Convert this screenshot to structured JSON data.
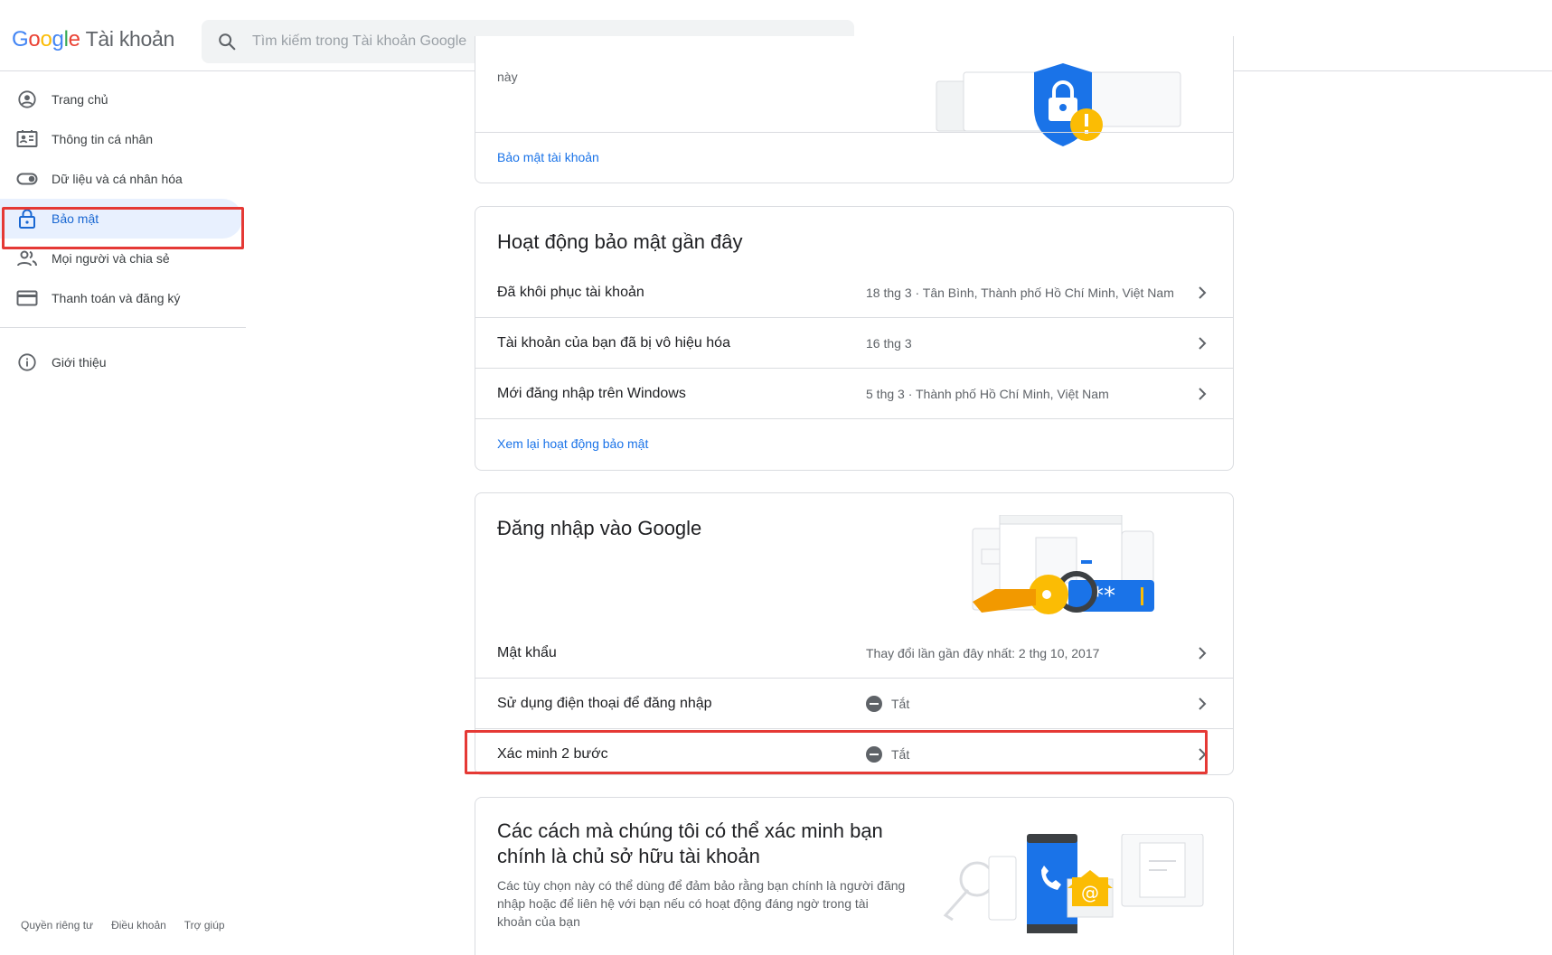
{
  "header": {
    "logo_letters": [
      "G",
      "o",
      "o",
      "g",
      "l",
      "e"
    ],
    "product": "Tài khoản",
    "search_placeholder": "Tìm kiếm trong Tài khoản Google"
  },
  "sidebar": {
    "items": [
      {
        "label": "Trang chủ",
        "icon": "account-circle-icon"
      },
      {
        "label": "Thông tin cá nhân",
        "icon": "contact-card-icon"
      },
      {
        "label": "Dữ liệu và cá nhân hóa",
        "icon": "toggle-icon"
      },
      {
        "label": "Bảo mật",
        "icon": "lock-icon",
        "active": true
      },
      {
        "label": "Mọi người và chia sẻ",
        "icon": "people-icon"
      },
      {
        "label": "Thanh toán và đăng ký",
        "icon": "credit-card-icon"
      }
    ],
    "about": {
      "label": "Giới thiệu",
      "icon": "info-icon"
    }
  },
  "footer": {
    "privacy": "Quyền riêng tư",
    "terms": "Điều khoản",
    "help": "Trợ giúp"
  },
  "security_card": {
    "partial_text": "này",
    "link": "Bảo mật tài khoản"
  },
  "recent_activity": {
    "title": "Hoạt động bảo mật gần đây",
    "rows": [
      {
        "label": "Đã khôi phục tài khoản",
        "value": "18 thg 3 · Tân Bình, Thành phố Hồ Chí Minh, Việt Nam"
      },
      {
        "label": "Tài khoản của bạn đã bị vô hiệu hóa",
        "value": "16 thg 3"
      },
      {
        "label": "Mới đăng nhập trên Windows",
        "value": "5 thg 3 · Thành phố Hồ Chí Minh, Việt Nam"
      }
    ],
    "link": "Xem lại hoạt động bảo mật"
  },
  "signin": {
    "title": "Đăng nhập vào Google",
    "rows": [
      {
        "label": "Mật khẩu",
        "value": "Thay đổi lần gần đây nhất: 2 thg 10, 2017"
      },
      {
        "label": "Sử dụng điện thoại để đăng nhập",
        "value": "Tắt"
      },
      {
        "label": "Xác minh 2 bước",
        "value": "Tắt"
      }
    ]
  },
  "verify": {
    "title_line1": "Các cách mà chúng tôi có thể xác minh bạn",
    "title_line2": "chính là chủ sở hữu tài khoản",
    "desc_line1": "Các tùy chọn này có thể dùng để đảm bảo rằng bạn chính là người đăng",
    "desc_line2": "nhập hoặc để liên hệ với bạn nếu có hoạt động đáng ngờ trong tài",
    "desc_line3": "khoản của bạn"
  },
  "colors": {
    "accent": "#1a73e8",
    "active_bg": "#e8f0fe",
    "highlight_red": "#e53935",
    "border": "#dadce0"
  }
}
